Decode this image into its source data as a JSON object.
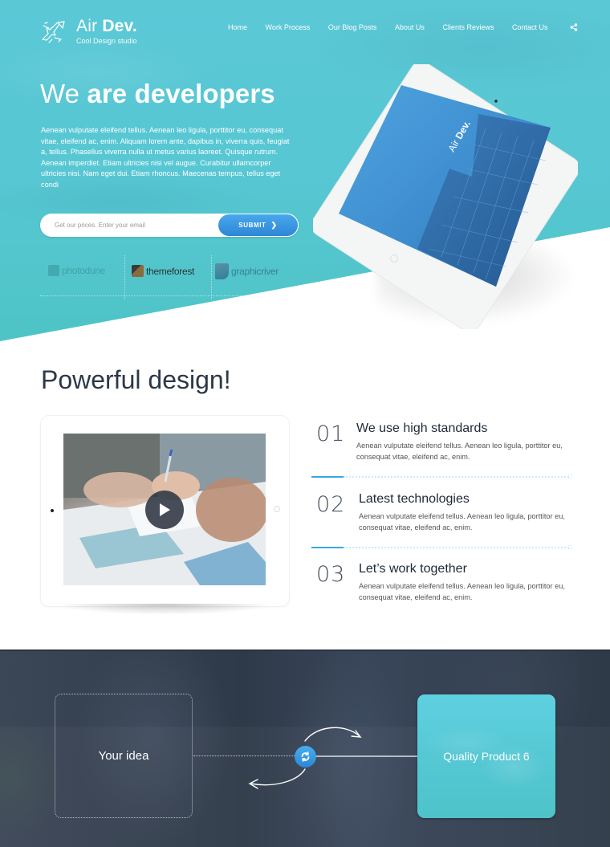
{
  "brand": {
    "name_light": "Air",
    "name_bold": "Dev.",
    "tagline": "Cool Design studio"
  },
  "nav": {
    "items": [
      "Home",
      "Work Process",
      "Our Blog Posts",
      "About Us",
      "Clients Reviews",
      "Contact Us"
    ],
    "share_icon": "share-icon"
  },
  "hero": {
    "title_light": "We",
    "title_bold": "are developers",
    "description": "Aenean vulputate eleifend tellus. Aenean leo ligula, porttitor eu, consequat vitae, eleifend ac, enim. Aliquam lorem ante, dapibus in, viverra quis, feugiat a, tellus. Phasellus viverra nulla ut metus varius laoreet. Quisque rutrum. Aenean imperdiet. Etiam ultricies nisi vel augue. Curabitur ullamcorper ultricies nisi. Nam eget dui. Etiam rhoncus. Maecenas tempus, tellus eget condi",
    "email_placeholder": "Get our prices. Enter your email",
    "email_value": "",
    "submit_label": "SUBMIT",
    "partners": [
      "photodune",
      "themeforest",
      "graphicriver"
    ],
    "tablet_brand_light": "Air",
    "tablet_brand_bold": "Dev.",
    "colors": {
      "accent": "#57c7d3",
      "button": "#3a96e0"
    }
  },
  "design": {
    "title": "Powerful design!",
    "features": [
      {
        "number": "01",
        "title": "We use high standards",
        "description": "Aenean vulputate eleifend tellus. Aenean leo ligula, porttitor eu, consequat vitae, eleifend ac, enim."
      },
      {
        "number": "02",
        "title": "Latest technologies",
        "description": "Aenean vulputate eleifend tellus. Aenean leo ligula, porttitor eu, consequat vitae, eleifend ac, enim."
      },
      {
        "number": "03",
        "title": "Let’s work together",
        "description": "Aenean vulputate eleifend tellus. Aenean leo ligula, porttitor eu, consequat vitae, eleifend ac, enim."
      }
    ]
  },
  "process": {
    "idea_label": "Your idea",
    "product_label": "Quality Product 6"
  }
}
